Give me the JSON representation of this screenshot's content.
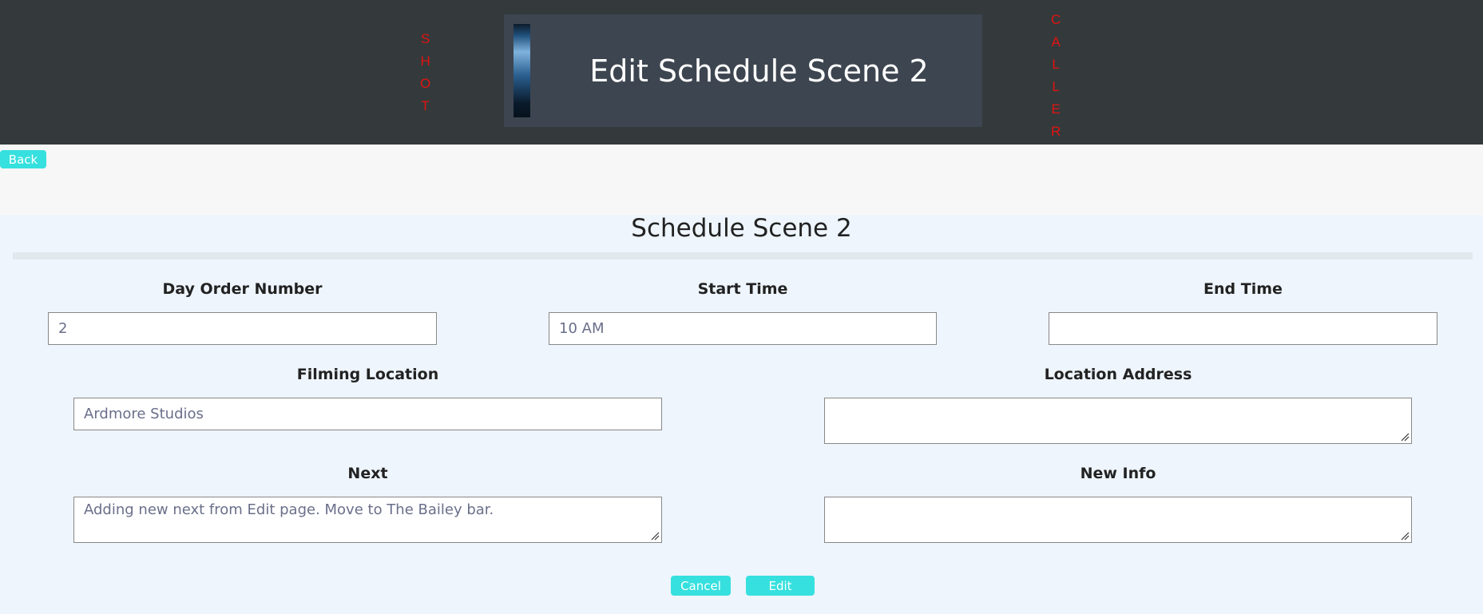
{
  "header": {
    "left_vertical_word": [
      "S",
      "H",
      "O",
      "T"
    ],
    "right_vertical_word": [
      "C",
      "A",
      "L",
      "L",
      "E",
      "R"
    ],
    "title": "Edit Schedule Scene 2"
  },
  "nav": {
    "back_label": "Back"
  },
  "form": {
    "title": "Schedule Scene 2",
    "day_order": {
      "label": "Day Order Number",
      "value": "2"
    },
    "start_time": {
      "label": "Start Time",
      "value": "10 AM"
    },
    "end_time": {
      "label": "End Time",
      "value": ""
    },
    "filming_location": {
      "label": "Filming Location",
      "value": "Ardmore Studios"
    },
    "location_address": {
      "label": "Location Address",
      "value": ""
    },
    "next": {
      "label": "Next",
      "value": "Adding new next from Edit page. Move to The Bailey bar."
    },
    "new_info": {
      "label": "New Info",
      "value": ""
    },
    "cancel_label": "Cancel",
    "edit_label": "Edit"
  },
  "colors": {
    "header_bg": "#343a3b",
    "accent": "#36e0de",
    "vertical_text": "#e31212",
    "page_bg": "#eef5fd"
  }
}
